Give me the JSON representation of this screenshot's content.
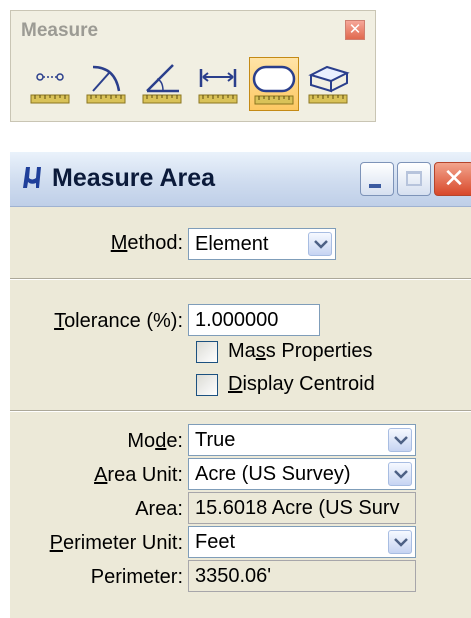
{
  "toolbox": {
    "title": "Measure",
    "tools": [
      {
        "icon": "measure-distance-icon",
        "selected": false
      },
      {
        "icon": "measure-radius-icon",
        "selected": false
      },
      {
        "icon": "measure-angle-icon",
        "selected": false
      },
      {
        "icon": "measure-length-icon",
        "selected": false
      },
      {
        "icon": "measure-area-icon",
        "selected": true
      },
      {
        "icon": "measure-volume-icon",
        "selected": false
      }
    ]
  },
  "dialog": {
    "title": "Measure Area",
    "method": {
      "label_pre": "",
      "label_ul": "M",
      "label_post": "ethod:",
      "value": "Element"
    },
    "tolerance": {
      "label_pre": "",
      "label_ul": "T",
      "label_post": "olerance (%):",
      "value": "1.000000"
    },
    "mass_properties": {
      "label_pre": "Ma",
      "label_ul": "s",
      "label_post": "s Properties",
      "checked": false
    },
    "display_centroid": {
      "label_pre": "",
      "label_ul": "D",
      "label_post": "isplay Centroid",
      "checked": false
    },
    "mode": {
      "label_pre": "Mo",
      "label_ul": "d",
      "label_post": "e:",
      "value": "True"
    },
    "area_unit": {
      "label_pre": "",
      "label_ul": "A",
      "label_post": "rea Unit:",
      "value": "Acre (US Survey)"
    },
    "area": {
      "label": "Area:",
      "value": "15.6018 Acre (US Surv"
    },
    "perimeter_unit": {
      "label_pre": "",
      "label_ul": "P",
      "label_post": "erimeter Unit:",
      "value": "Feet"
    },
    "perimeter": {
      "label": "Perimeter:",
      "value": "3350.06'"
    }
  },
  "colors": {
    "titlebar": "#cfdcef",
    "dialog_bg": "#ece9d8",
    "selected_tool": "#fdc862",
    "close_button": "#d8482a"
  }
}
